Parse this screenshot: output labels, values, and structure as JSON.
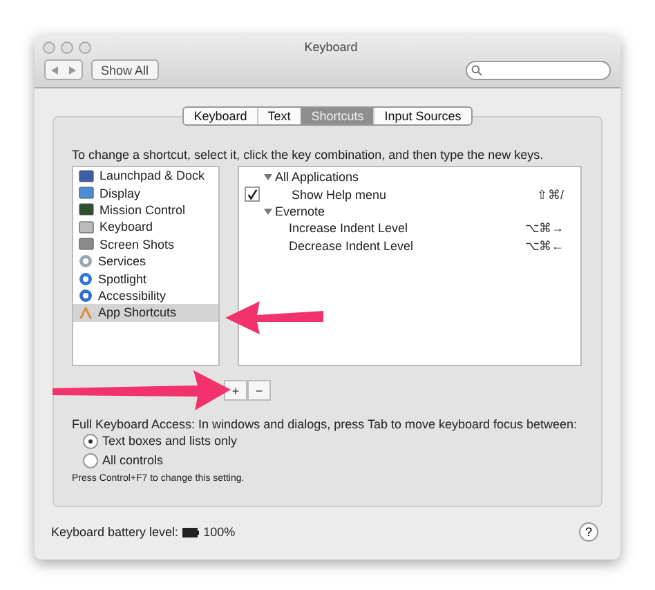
{
  "window": {
    "title": "Keyboard"
  },
  "toolbar": {
    "show_all": "Show All"
  },
  "tabs": [
    {
      "label": "Keyboard",
      "selected": false
    },
    {
      "label": "Text",
      "selected": false
    },
    {
      "label": "Shortcuts",
      "selected": true
    },
    {
      "label": "Input Sources",
      "selected": false
    }
  ],
  "instruction": "To change a shortcut, select it, click the key combination, and then type the new keys.",
  "categories": [
    {
      "label": "Launchpad & Dock",
      "selected": false
    },
    {
      "label": "Display",
      "selected": false
    },
    {
      "label": "Mission Control",
      "selected": false
    },
    {
      "label": "Keyboard",
      "selected": false
    },
    {
      "label": "Screen Shots",
      "selected": false
    },
    {
      "label": "Services",
      "selected": false
    },
    {
      "label": "Spotlight",
      "selected": false
    },
    {
      "label": "Accessibility",
      "selected": false
    },
    {
      "label": "App Shortcuts",
      "selected": true
    }
  ],
  "shortcuts": [
    {
      "label": "All Applications",
      "expanded": true,
      "children": [
        {
          "label": "Show Help menu",
          "checked": true,
          "keys": "⇧⌘/"
        }
      ]
    },
    {
      "label": "Evernote",
      "expanded": true,
      "children": [
        {
          "label": "Increase Indent Level",
          "keys": "⌥⌘→"
        },
        {
          "label": "Decrease Indent Level",
          "keys": "⌥⌘←"
        }
      ]
    }
  ],
  "list_buttons": [
    "+",
    "−"
  ],
  "keyboard_access": {
    "label": "Full Keyboard Access: In windows and dialogs, press Tab to move keyboard focus between:",
    "options": [
      {
        "label": "Text boxes and lists only",
        "selected": true
      },
      {
        "label": "All controls",
        "selected": false
      }
    ],
    "hint": "Press Control+F7 to change this setting."
  },
  "footer": {
    "battery_label": "Keyboard battery level:",
    "battery_value": "100%",
    "help": "?"
  }
}
